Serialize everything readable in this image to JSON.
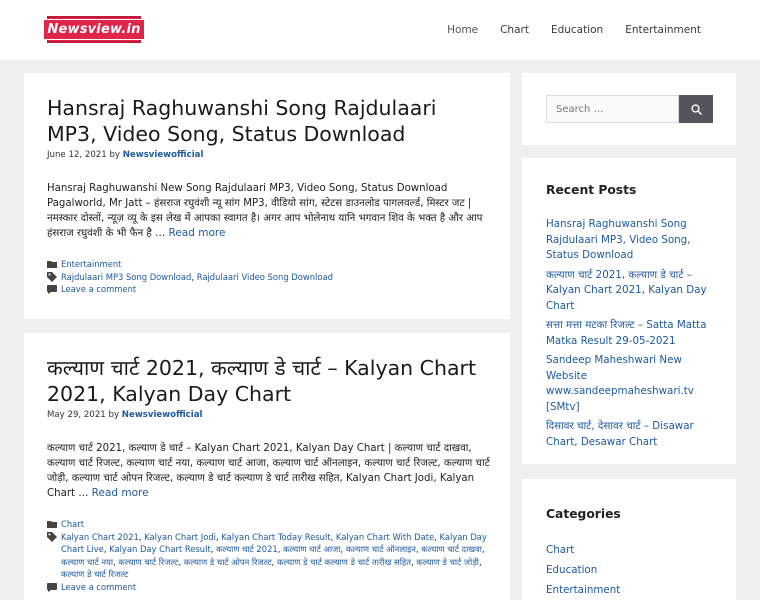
{
  "site": {
    "logo_text": "Newsview.in",
    "nav": [
      "Home",
      "Chart",
      "Education",
      "Entertainment"
    ]
  },
  "posts": [
    {
      "title": "Hansraj Raghuwanshi Song Rajdulaari MP3, Video Song, Status Download",
      "date": "June 12, 2021",
      "by": "by",
      "author": "Newsviewofficial",
      "excerpt": "Hansraj Raghuwanshi New Song Rajdulaari MP3, Video Song, Status Download Pagalworld, Mr Jatt – हंसराज रघुवंशी न्यू सांग MP3, वीडियो सांग, स्टेटस डाउनलोड पागलवर्ल्ड, मिस्टर जट | नमस्कार दोस्तों, न्यूज़ व्यू के इस लेख में आपका स्वागत है। अगर आप भोलेनाथ यानि भगवान शिव के भक्त है और आप हंसराज रघुवंशी के भी फैन है …",
      "read_more": "Read more",
      "category": "Entertainment",
      "tags": [
        "Rajdulaari MP3 Song Download",
        "Rajdulaari Video Song Download"
      ],
      "comment": "Leave a comment"
    },
    {
      "title": "कल्याण चार्ट 2021, कल्याण डे चार्ट – Kalyan Chart 2021, Kalyan Day Chart",
      "date": "May 29, 2021",
      "by": "by",
      "author": "Newsviewofficial",
      "excerpt": "कल्याण चार्ट 2021, कल्याण डे चार्ट – Kalyan Chart 2021, Kalyan Day Chart | कल्याण चार्ट दाखवा, कल्याण चार्ट रिजल्ट, कल्याण चार्ट नया, कल्याण चार्ट आजा, कल्याण चार्ट ऑनलाइन, कल्याण चार्ट रिजल्ट, कल्याण चार्ट जोड़ी, कल्याण चार्ट ओपन रिजल्ट, कल्याण डे चार्ट कल्याण डे चार्ट तारीख सहित, Kalyan Chart Jodi, Kalyan Chart …",
      "read_more": "Read more",
      "category": "Chart",
      "tags": [
        "Kalyan Chart 2021",
        "Kalyan Chart Jodi",
        "Kalyan Chart Today Result",
        "Kalyan Chart With Date",
        "Kalyan Day Chart Live",
        "Kalyan Day Chart Result",
        "कल्याण चार्ट 2021",
        "कल्याण चार्ट आजा",
        "कल्याण चार्ट ऑनलाइन",
        "कल्याण चार्ट दाखवा",
        "कल्याण चार्ट नया",
        "कल्याण चार्ट रिजल्ट",
        "कल्याण डे चार्ट ओपन रिजल्ट",
        "कल्याण डे चार्ट कल्याण डे चार्ट तारीख सहित",
        "कल्याण डे चार्ट जोड़ी",
        "कल्याण डे चार्ट रिजल्ट"
      ],
      "comment": "Leave a comment"
    }
  ],
  "sidebar": {
    "search_placeholder": "Search …",
    "recent_title": "Recent Posts",
    "recent": [
      "Hansraj Raghuwanshi Song Rajdulaari MP3, Video Song, Status Download",
      "कल्याण चार्ट 2021, कल्याण डे चार्ट – Kalyan Chart 2021, Kalyan Day Chart",
      "सत्ता मत्ता मटका रिजल्ट – Satta Matta Matka Result 29-05-2021",
      "Sandeep Maheshwari New Website www.sandeepmaheshwari.tv [SMtv]",
      "दिसावर चार्ट, देसावर चार्ट – Disawar Chart, Desawar Chart"
    ],
    "categories_title": "Categories",
    "categories": [
      "Chart",
      "Education",
      "Entertainment"
    ]
  },
  "colors": {
    "link": "#1e5aa0",
    "logo": "#e0254a",
    "search_button": "#55555e"
  },
  "icons": {
    "category": "folder-icon",
    "tags": "tag-icon",
    "comment": "comment-icon",
    "search": "search-icon"
  }
}
